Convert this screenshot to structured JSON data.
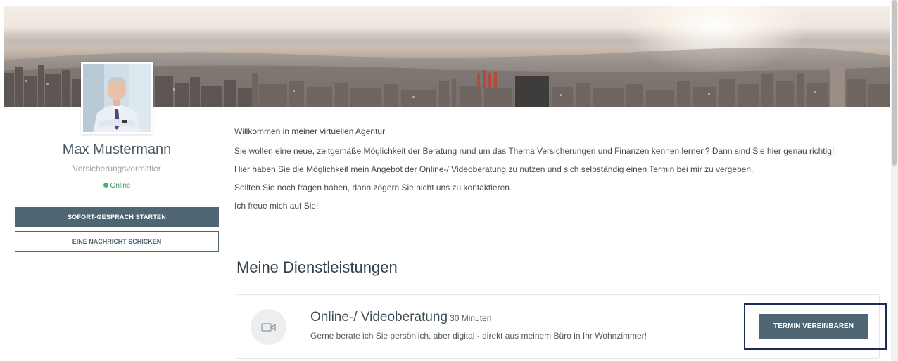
{
  "profile": {
    "name": "Max Mustermann",
    "role": "Versicherungsvermittler",
    "status": "Online"
  },
  "actions": {
    "start_call": "SOFORT-GESPRÄCH STARTEN",
    "send_message": "EINE NACHRICHT SCHICKEN"
  },
  "intro": {
    "title": "Willkommen in meiner virtuellen Agentur",
    "paragraphs": [
      "Sie wollen eine neue, zeitgemäße Möglichkeit der Beratung rund um das Thema Versicherungen und Finanzen kennen lernen? Dann sind Sie hier genau richtig!",
      "Hier haben Sie die Möglichkeit mein Angebot der Online-/ Videoberatung zu nutzen und sich selbständig einen Termin bei mir zu vergeben.",
      "Sollten Sie noch fragen haben, dann zögern Sie nicht uns zu kontaktieren.",
      "Ich freue mich auf Sie!"
    ]
  },
  "services": {
    "title": "Meine Dienstleistungen",
    "items": [
      {
        "icon": "video-camera-icon",
        "title": "Online-/ Videoberatung",
        "duration": "30 Minuten",
        "description": "Gerne berate ich Sie persönlich, aber digital - direkt aus meinem Büro in Ihr Wohnzimmer!",
        "button": "TERMIN VEREINBAREN"
      }
    ]
  },
  "colors": {
    "accent": "#4e6673",
    "online": "#3fb36a",
    "highlight_frame": "#1d2b57"
  }
}
